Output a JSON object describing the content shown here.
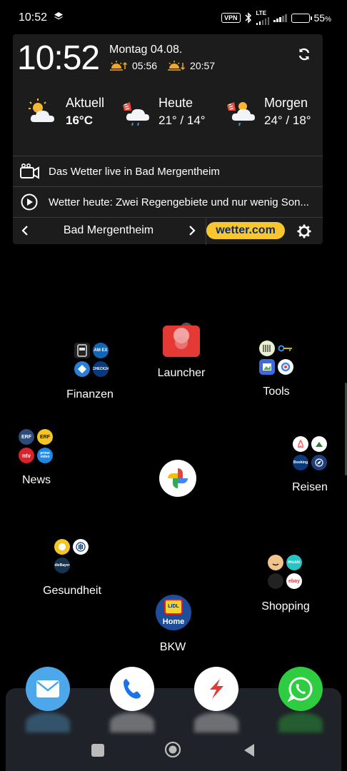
{
  "status_bar": {
    "time": "10:52",
    "vpn": "VPN",
    "lte": "LTE",
    "battery_percent": "55",
    "battery_unit": "%",
    "battery_level": 0.55
  },
  "widget": {
    "clock": "10:52",
    "date": "Montag 04.08.",
    "sunrise": "05:56",
    "sunset": "20:57",
    "forecast": [
      {
        "label": "Aktuell",
        "value": "16°C"
      },
      {
        "label": "Heute",
        "value": "21° / 14°"
      },
      {
        "label": "Morgen",
        "value": "24° / 18°"
      }
    ],
    "live_text": "Das Wetter live in Bad Mergentheim",
    "video_text": "Wetter heute: Zwei Regengebiete und nur wenig Son...",
    "city": "Bad Mergentheim",
    "brand": "wetter.com"
  },
  "home": {
    "folders": {
      "finanzen": {
        "label": "Finanzen",
        "mini": [
          "",
          "AM EX",
          "",
          "CHECK24"
        ]
      },
      "launcher": {
        "label": "Launcher"
      },
      "tools": {
        "label": "Tools"
      },
      "news": {
        "label": "News",
        "mini": [
          "ERF",
          "ERF",
          "ntv",
          "prime video"
        ]
      },
      "reisen": {
        "label": "Reisen",
        "mini": [
          "",
          "",
          "Booking",
          ""
        ]
      },
      "gesundheit": {
        "label": "Gesundheit",
        "mini": [
          "",
          "",
          "dieBayer",
          ""
        ]
      },
      "shopping": {
        "label": "Shopping",
        "mini": [
          "",
          "music",
          "",
          "ebay"
        ]
      },
      "bkw": {
        "label": "BKW",
        "badge": "LIDL",
        "sub": "Home"
      }
    }
  },
  "colors": {
    "widget_bg": "#1c1c1c",
    "brand_yellow": "#f8c62e",
    "brand_blue": "#0a2b6b",
    "dock_bg": "#1f2228"
  }
}
